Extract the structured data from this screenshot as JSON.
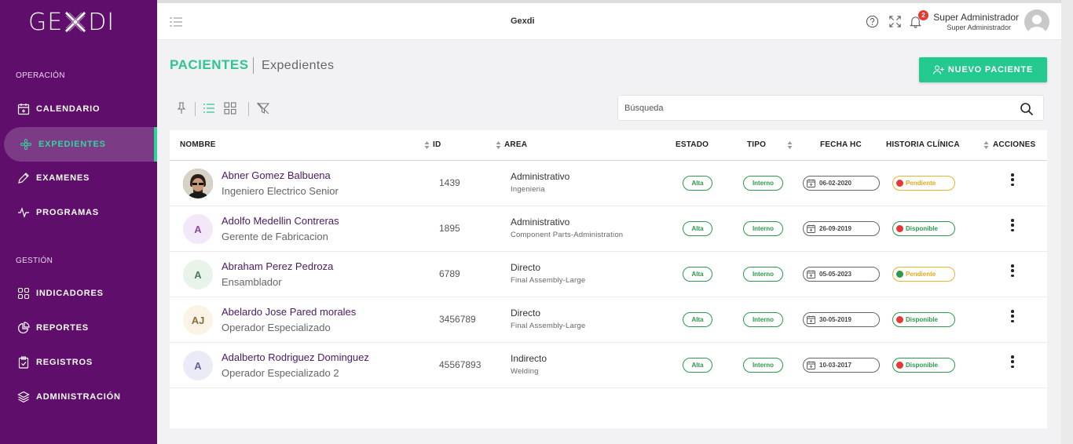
{
  "brand": {
    "logo_left": "GE",
    "logo_right": "DI"
  },
  "sidebar": {
    "section_operacion": "OPERACIÓN",
    "section_gestion": "GESTIÓN",
    "items": [
      {
        "label": "CALENDARIO",
        "icon": "calendar-icon"
      },
      {
        "label": "EXPEDIENTES",
        "icon": "flower-icon",
        "active": true
      },
      {
        "label": "EXAMENES",
        "icon": "pencil-icon"
      },
      {
        "label": "PROGRAMAS",
        "icon": "pulse-icon"
      },
      {
        "label": "INDICADORES",
        "icon": "grid-icon"
      },
      {
        "label": "REPORTES",
        "icon": "pie-chart-icon"
      },
      {
        "label": "REGISTROS",
        "icon": "clipboard-icon"
      },
      {
        "label": "ADMINISTRACIÓN",
        "icon": "layers-icon"
      }
    ]
  },
  "topbar": {
    "title": "Gexdi",
    "notification_count": "2",
    "user_name": "Super Administrador",
    "user_role": "Super Administrador"
  },
  "header": {
    "title": "PACIENTES",
    "subtitle": "Expedientes",
    "new_button": "NUEVO PACIENTE"
  },
  "search": {
    "placeholder": "Búsqueda"
  },
  "table": {
    "columns": [
      "NOMBRE",
      "ID",
      "AREA",
      "ESTADO",
      "TIPO",
      "FECHA HC",
      "HISTORIA CLÍNICA",
      "ACCIONES"
    ],
    "rows": [
      {
        "initials": "",
        "name": "Abner Gomez Balbuena",
        "job": "Ingeniero Electrico Senior",
        "id": "1439",
        "area": "Administrativo",
        "area_sub": "Ingenieria",
        "estado": "Alta",
        "tipo": "Interno",
        "fecha": "06-02-2020",
        "historia": "Pendiente",
        "historia_color": "#e53935"
      },
      {
        "initials": "A",
        "name": "Adolfo Medellin Contreras",
        "job": "Gerente de Fabricacion",
        "id": "1895",
        "area": "Administrativo",
        "area_sub": "Component Parts-Administration",
        "estado": "Alta",
        "tipo": "Interno",
        "fecha": "26-09-2019",
        "historia": "Disponible",
        "historia_color": "#e53935"
      },
      {
        "initials": "A",
        "name": "Abraham Perez Pedroza",
        "job": "Ensamblador",
        "id": "6789",
        "area": "Directo",
        "area_sub": "Final Assembly-Large",
        "estado": "Alta",
        "tipo": "Interno",
        "fecha": "05-05-2023",
        "historia": "Pendiente",
        "historia_color": "#2b9a4a"
      },
      {
        "initials": "AJ",
        "name": "Abelardo Jose Pared morales",
        "job": "Operador Especializado",
        "id": "3456789",
        "area": "Directo",
        "area_sub": "Final Assembly-Large",
        "estado": "Alta",
        "tipo": "Interno",
        "fecha": "30-05-2019",
        "historia": "Disponible",
        "historia_color": "#e53935"
      },
      {
        "initials": "A",
        "name": "Adalberto Rodriguez Dominguez",
        "job": "Operador Especializado 2",
        "id": "45567893",
        "area": "Indirecto",
        "area_sub": "Welding",
        "estado": "Alta",
        "tipo": "Interno",
        "fecha": "10-03-2017",
        "historia": "Disponible",
        "historia_color": "#e53935"
      }
    ]
  },
  "colors": {
    "sidebar": "#600e6b",
    "accent": "#24c98f",
    "pending": "#e7b52a",
    "available": "#2b9a4a"
  }
}
